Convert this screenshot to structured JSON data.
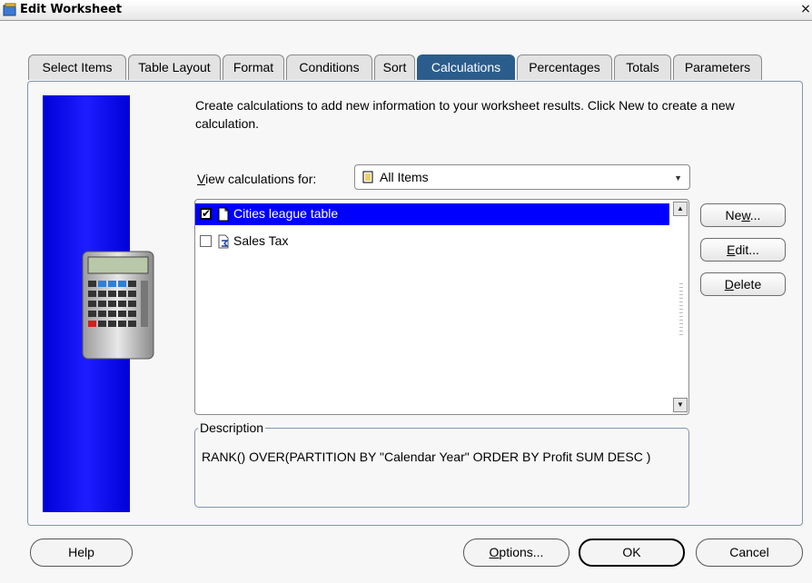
{
  "window": {
    "title": "Edit Worksheet",
    "close_glyph": "×"
  },
  "tabs": [
    {
      "label": "Select Items"
    },
    {
      "label": "Table Layout"
    },
    {
      "label": "Format"
    },
    {
      "label": "Conditions"
    },
    {
      "label": "Sort"
    },
    {
      "label": "Calculations"
    },
    {
      "label": "Percentages"
    },
    {
      "label": "Totals"
    },
    {
      "label": "Parameters"
    }
  ],
  "active_tab": "Calculations",
  "intro": "Create calculations to add new information to your worksheet results.  Click New to create a new calculation.",
  "view": {
    "label": "iew calculations for:",
    "label_mnemonic": "V",
    "selected": "All Items"
  },
  "calculations": [
    {
      "label": "Cities league table",
      "checked": true,
      "selected": true,
      "icon": "calculation-doc-icon"
    },
    {
      "label": "Sales Tax",
      "checked": false,
      "selected": false,
      "icon": "calculation-sum-icon"
    }
  ],
  "side_buttons": {
    "new": {
      "pre": "Ne",
      "mn": "w",
      "post": "..."
    },
    "edit": {
      "pre": "",
      "mn": "E",
      "post": "dit..."
    },
    "delete": {
      "pre": "",
      "mn": "D",
      "post": "elete"
    }
  },
  "description": {
    "legend": "Description",
    "text": "RANK() OVER(PARTITION BY \"Calendar Year\"  ORDER BY  Profit SUM DESC )"
  },
  "footer": {
    "help": "Help",
    "options": {
      "mn": "O",
      "post": "ptions..."
    },
    "ok": "OK",
    "cancel": "Cancel"
  },
  "colors": {
    "active_tab": "#2b5d8c",
    "selection": "#0000ff",
    "side_panel": "#0000d8"
  }
}
